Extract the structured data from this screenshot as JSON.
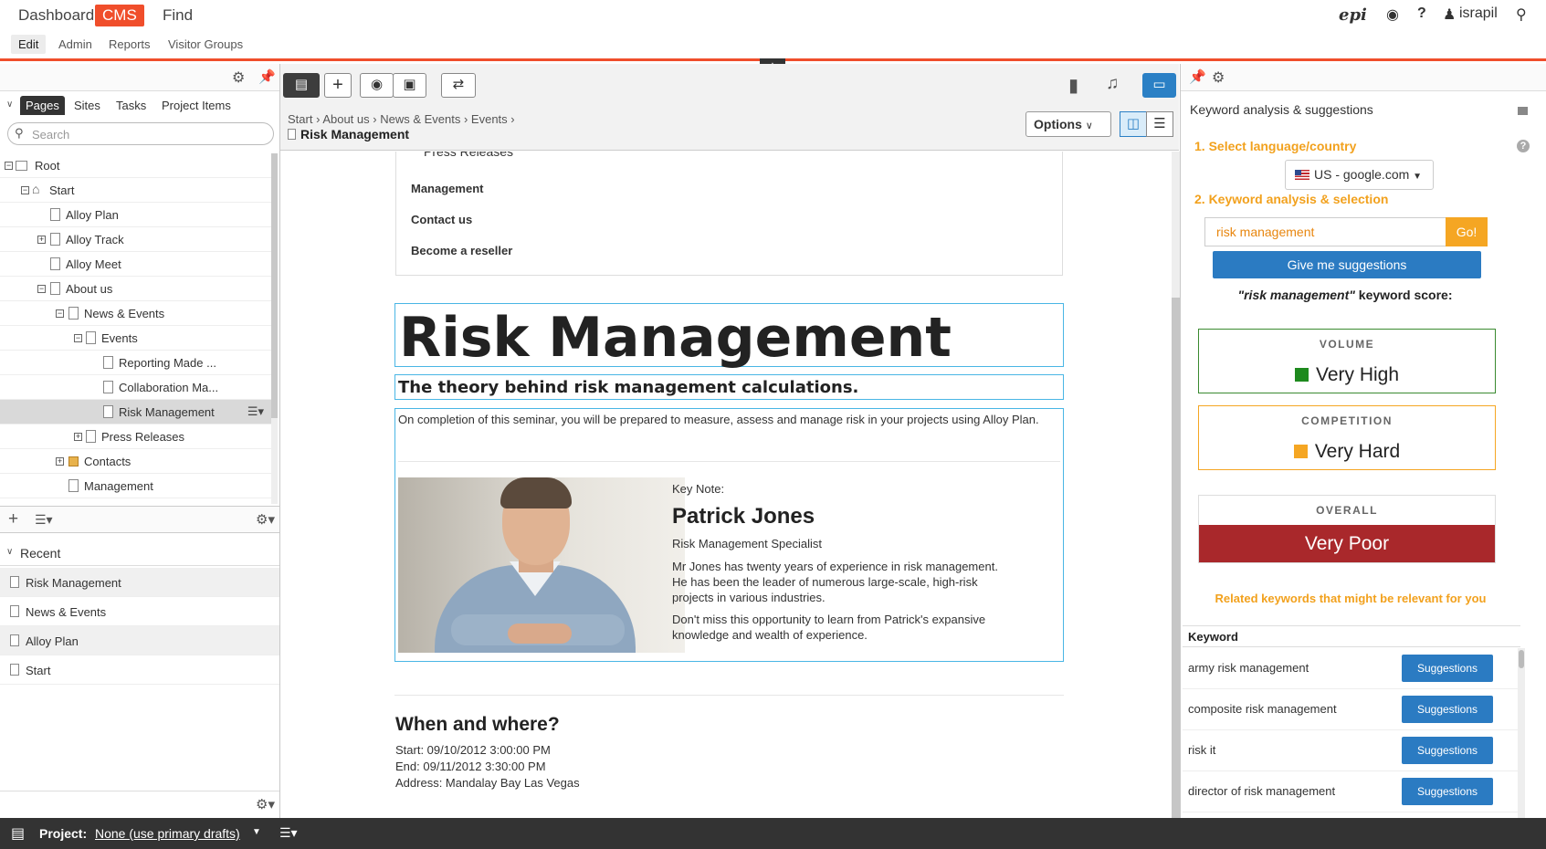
{
  "topnav": {
    "products": [
      "Dashboard",
      "CMS",
      "Find"
    ],
    "subnav": [
      "Edit",
      "Admin",
      "Reports",
      "Visitor Groups"
    ],
    "user": "israpil",
    "help": "?"
  },
  "left": {
    "tabs": [
      "Pages",
      "Sites",
      "Tasks",
      "Project Items"
    ],
    "search_placeholder": "Search",
    "tree": [
      "Root",
      "Start",
      "Alloy Plan",
      "Alloy Track",
      "Alloy Meet",
      "About us",
      "News & Events",
      "Events",
      "Reporting Made ...",
      "Collaboration Ma...",
      "Risk Management",
      "Press Releases",
      "Contacts",
      "Management"
    ],
    "recent_title": "Recent",
    "recent": [
      "Risk Management",
      "News & Events",
      "Alloy Plan",
      "Start"
    ]
  },
  "center": {
    "breadcrumb": [
      "Start",
      "About us",
      "News & Events",
      "Events"
    ],
    "current_page": "Risk Management",
    "options_label": "Options",
    "menu": {
      "sub": "Press Releases",
      "items": [
        "Management",
        "Contact us",
        "Become a reseller"
      ]
    },
    "page": {
      "title": "Risk Management",
      "subtitle": "The theory behind risk management calculations.",
      "intro": "On completion of this seminar, you will be prepared to measure, assess and manage risk in your projects using Alloy Plan.",
      "keynote_label": "Key Note:",
      "person_name": "Patrick Jones",
      "person_role": "Risk Management Specialist",
      "bio1": "Mr Jones has twenty years of experience in risk management. He has been the leader of numerous large-scale, high-risk projects in various industries.",
      "bio2": "Don't miss this opportunity to learn from Patrick's expansive knowledge and wealth of experience.",
      "when_title": "When and where?",
      "start": "Start: 09/10/2012 3:00:00 PM",
      "end": "End: 09/11/2012 3:30:00 PM",
      "address": "Address: Mandalay Bay Las Vegas"
    }
  },
  "right": {
    "panel_title": "Keyword analysis & suggestions",
    "step1": "1. Select language/country",
    "language": "US - google.com",
    "step2": "2. Keyword analysis & selection",
    "keyword_value": "risk management",
    "go_label": "Go!",
    "give_label": "Give me suggestions",
    "score_keyword": "\"risk management\"",
    "score_suffix": "keyword score:",
    "volume_cap": "VOLUME",
    "volume_val": "Very High",
    "competition_cap": "COMPETITION",
    "competition_val": "Very Hard",
    "overall_cap": "OVERALL",
    "overall_val": "Very Poor",
    "related_text": "Related keywords that might be relevant for you",
    "table_head": "Keyword",
    "suggest_label": "Suggestions",
    "keywords": [
      "army risk management",
      "composite risk management",
      "risk it",
      "director of risk management"
    ],
    "colors": {
      "volume": "#1e8a1e",
      "competition": "#f5a623",
      "overall": "#a9282b"
    }
  },
  "bottom": {
    "project_label": "Project:",
    "project_value": "None (use primary drafts)"
  }
}
